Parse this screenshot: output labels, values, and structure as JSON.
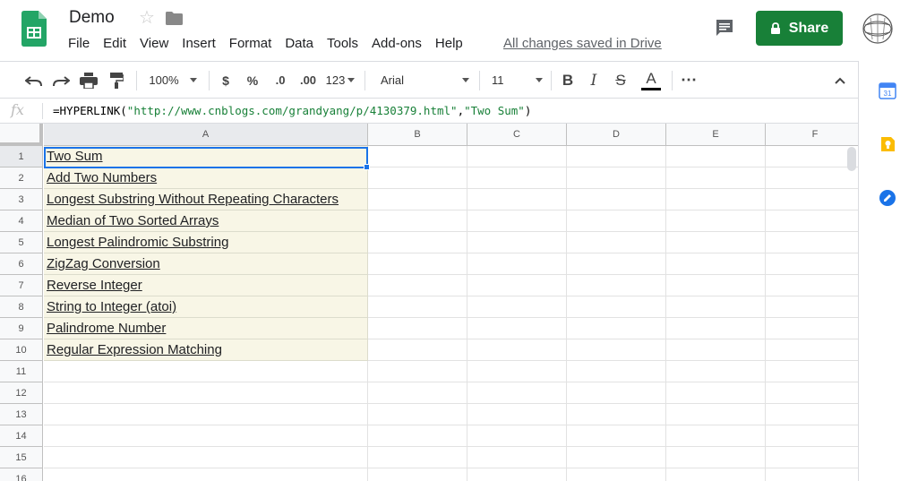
{
  "app": {
    "doc_title": "Demo",
    "menu": [
      "File",
      "Edit",
      "View",
      "Insert",
      "Format",
      "Data",
      "Tools",
      "Add-ons",
      "Help"
    ],
    "saved_status": "All changes saved in Drive",
    "share_label": "Share",
    "accent_color": "#188038"
  },
  "toolbar": {
    "zoom": "100%",
    "currency": "$",
    "percent": "%",
    "decrease_decimal": ".0",
    "increase_decimal": ".00",
    "more_formats": "123",
    "font_family": "Arial",
    "font_size": "11",
    "bold": "B",
    "italic": "I",
    "strikethrough": "S",
    "text_color": "A",
    "more": "⋯"
  },
  "formula_bar": {
    "fx": "fx",
    "formula_prefix": "=HYPERLINK(",
    "formula_url": "\"http://www.cnblogs.com/grandyang/p/4130379.html\"",
    "formula_sep": ",",
    "formula_label": "\"Two Sum\"",
    "formula_suffix": ")"
  },
  "sheet": {
    "columns": [
      "A",
      "B",
      "C",
      "D",
      "E",
      "F"
    ],
    "rows": [
      "1",
      "2",
      "3",
      "4",
      "5",
      "6",
      "7",
      "8",
      "9",
      "10",
      "11",
      "12",
      "13",
      "14",
      "15",
      "16"
    ],
    "column_a": [
      "Two Sum",
      "Add Two Numbers",
      "Longest Substring Without Repeating Characters",
      "Median of Two Sorted Arrays",
      "Longest Palindromic Substring",
      "ZigZag Conversion",
      "Reverse Integer",
      "String to Integer (atoi)",
      "Palindrome Number",
      "Regular Expression Matching"
    ],
    "selected_cell": "A1"
  },
  "side_panel": {
    "calendar_day": "31",
    "icons": [
      "calendar-icon",
      "keep-icon",
      "tasks-icon"
    ]
  }
}
